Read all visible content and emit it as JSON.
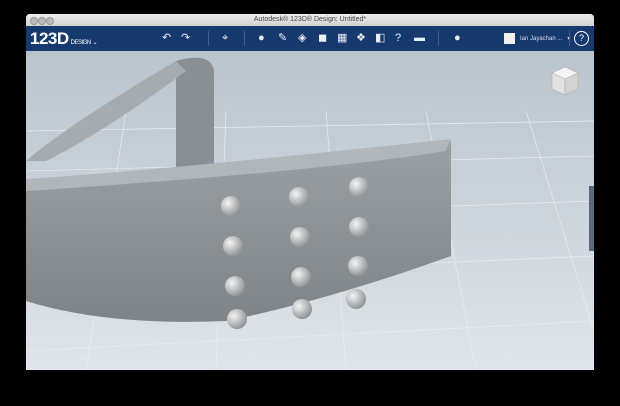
{
  "window": {
    "title": "Autodesk® 123D® Design: Untitled*"
  },
  "toolbar": {
    "logo": "123D",
    "logo_sub": "DESIGN",
    "tools": [
      {
        "icon": "undo-icon",
        "glyph": "↶"
      },
      {
        "icon": "redo-icon",
        "glyph": "↷"
      },
      {
        "icon": "transform-icon",
        "glyph": "⌖"
      },
      {
        "icon": "primitives-icon",
        "glyph": "●"
      },
      {
        "icon": "sketch-icon",
        "glyph": "✎"
      },
      {
        "icon": "construct-icon",
        "glyph": "◈"
      },
      {
        "icon": "modify-icon",
        "glyph": "◼"
      },
      {
        "icon": "pattern-icon",
        "glyph": "▦"
      },
      {
        "icon": "group-icon",
        "glyph": "❖"
      },
      {
        "icon": "combine-icon",
        "glyph": "◧"
      },
      {
        "icon": "measure-icon",
        "glyph": "?"
      },
      {
        "icon": "text-icon",
        "glyph": "▬"
      },
      {
        "icon": "material-icon",
        "glyph": "●"
      }
    ],
    "user": "Ian Jayachan ...",
    "help": "?"
  },
  "colors": {
    "toolbar": "#173a6e",
    "viewport": "#c9d3dc",
    "model": "#8c9296"
  }
}
